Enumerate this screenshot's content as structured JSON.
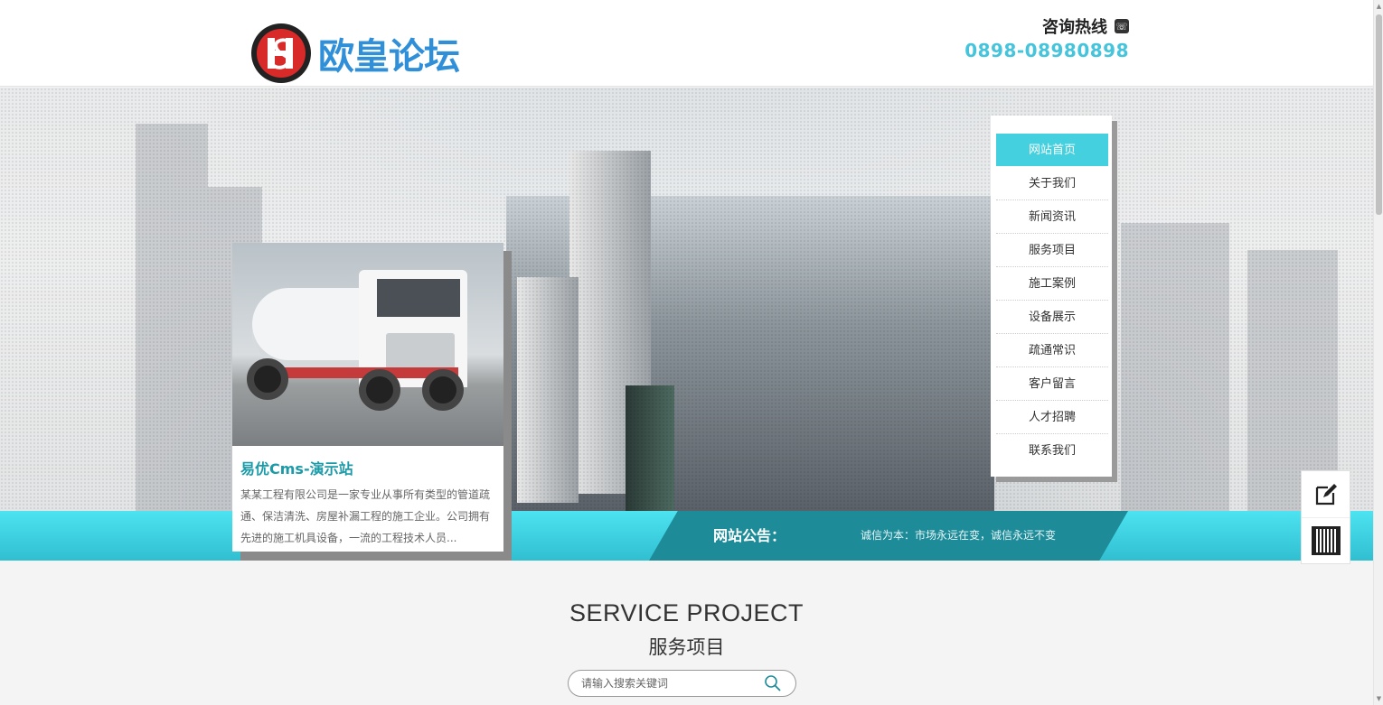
{
  "header": {
    "logo_text": "欧皇论坛",
    "hotline_label": "咨询热线",
    "hotline_number": "0898-08980898"
  },
  "nav": {
    "items": [
      {
        "label": "网站首页",
        "active": true
      },
      {
        "label": "关于我们"
      },
      {
        "label": "新闻资讯"
      },
      {
        "label": "服务项目"
      },
      {
        "label": "施工案例"
      },
      {
        "label": "设备展示"
      },
      {
        "label": "疏通常识"
      },
      {
        "label": "客户留言"
      },
      {
        "label": "人才招聘"
      },
      {
        "label": "联系我们"
      }
    ]
  },
  "feature": {
    "title": "易优Cms-演示站",
    "description": "某某工程有限公司是一家专业从事所有类型的管道疏通、保洁清洗、房屋补漏工程的施工企业。公司拥有先进的施工机具设备，一流的工程技术人员..."
  },
  "notice": {
    "label": "网站公告：",
    "text": "诚信为本：市场永远在变，诚信永远不变"
  },
  "section": {
    "title_en": "SERVICE PROJECT",
    "title_cn": "服务项目"
  },
  "search": {
    "placeholder": "请输入搜索关键词"
  },
  "colors": {
    "accent": "#44d0de",
    "notice_dark": "#1d8b98",
    "title_teal": "#1b9aa8",
    "logo_red": "#d92a2a",
    "logo_blue": "#2f8fd8"
  }
}
